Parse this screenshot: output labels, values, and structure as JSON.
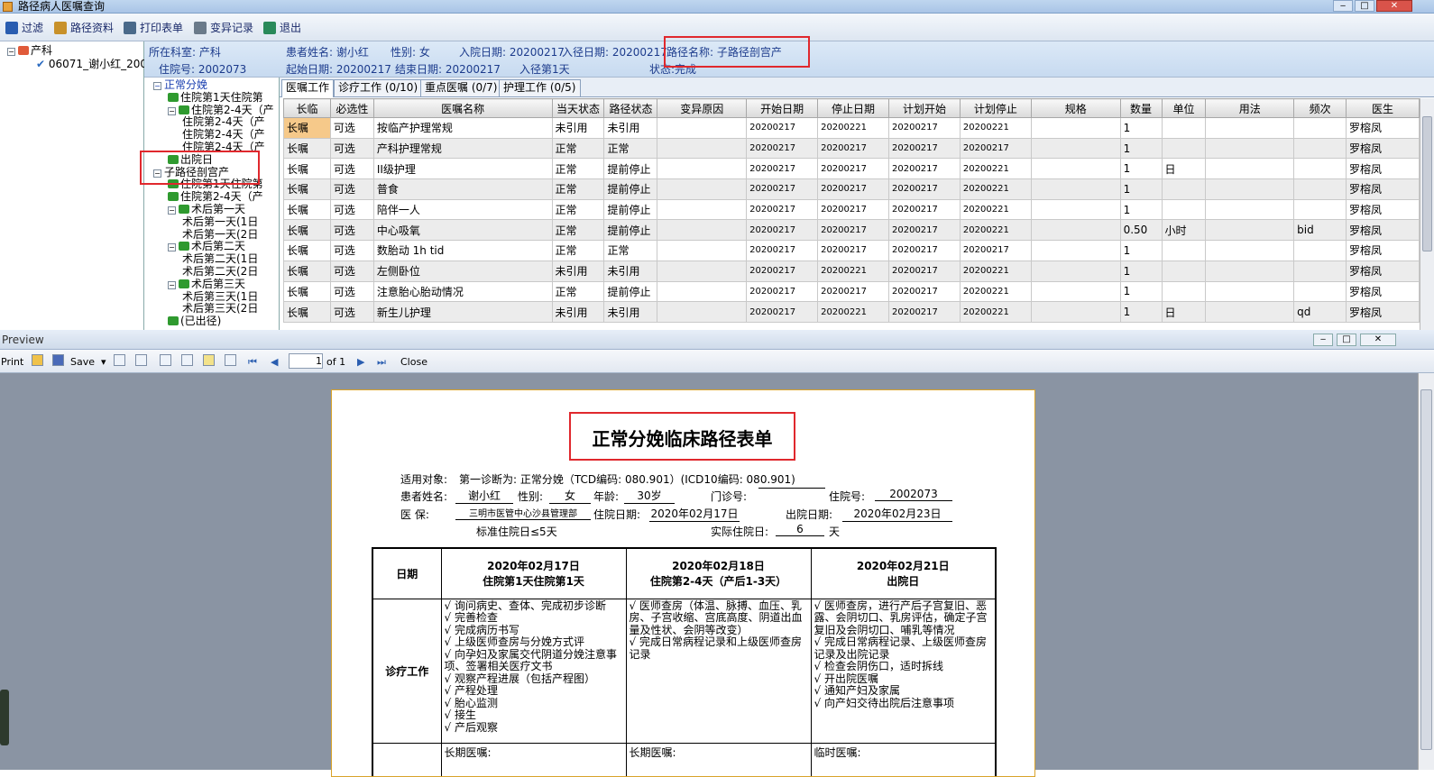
{
  "window": {
    "title": "路径病人医嘱查询",
    "btn_min": "‒",
    "btn_max": "□",
    "btn_close": "✕"
  },
  "toolbar": [
    {
      "label": "过滤",
      "icon": "filter-icon",
      "color": "#2a5db0"
    },
    {
      "label": "路径资料",
      "icon": "folder-icon",
      "color": "#c8912a"
    },
    {
      "label": "打印表单",
      "icon": "printer-icon",
      "color": "#4a6a8a"
    },
    {
      "label": "变异记录",
      "icon": "calculator-icon",
      "color": "#6a7a8a"
    },
    {
      "label": "退出",
      "icon": "exit-icon",
      "color": "#2a8a5a"
    }
  ],
  "tree_left": {
    "root": "产科",
    "child": "06071_谢小红_200"
  },
  "info": {
    "dept": "所在科室: 产科",
    "patient": "患者姓名: 谢小红",
    "gender": "性别:  女",
    "admit_date": "入院日期: 20200217",
    "path_in_date": "入径日期: 20200217",
    "path_name": "路径名称: 子路径剖宫产",
    "inpatient_no": "住院号: 2002073",
    "start_date": "起始日期: 20200217",
    "end_date": "结束日期: 20200217",
    "path_day": "入径第1天",
    "status": "状态:完成"
  },
  "tree_path": [
    {
      "text": "正常分娩",
      "level": 0,
      "type": "expander",
      "color": "#1a3fb0"
    },
    {
      "text": "住院第1天住院第",
      "level": 1,
      "type": "leaf"
    },
    {
      "text": "住院第2-4天（产",
      "level": 1,
      "type": "expleaf"
    },
    {
      "text": "住院第2-4天（产",
      "level": 2,
      "type": "text"
    },
    {
      "text": "住院第2-4天（产",
      "level": 2,
      "type": "text"
    },
    {
      "text": "住院第2-4天（产",
      "level": 2,
      "type": "text"
    },
    {
      "text": "出院日",
      "level": 1,
      "type": "leaf"
    },
    {
      "text": "子路径剖宫产",
      "level": 0,
      "type": "expander",
      "color": "#000"
    },
    {
      "text": "住院第1天住院第",
      "level": 1,
      "type": "leaf"
    },
    {
      "text": "住院第2-4天（产",
      "level": 1,
      "type": "leaf"
    },
    {
      "text": "术后第一天",
      "level": 1,
      "type": "expleaf"
    },
    {
      "text": "术后第一天(1日",
      "level": 2,
      "type": "text"
    },
    {
      "text": "术后第一天(2日",
      "level": 2,
      "type": "text"
    },
    {
      "text": "术后第二天",
      "level": 1,
      "type": "expleaf"
    },
    {
      "text": "术后第二天(1日",
      "level": 2,
      "type": "text"
    },
    {
      "text": "术后第二天(2日",
      "level": 2,
      "type": "text"
    },
    {
      "text": "术后第三天",
      "level": 1,
      "type": "expleaf"
    },
    {
      "text": "术后第三天(1日",
      "level": 2,
      "type": "text"
    },
    {
      "text": "术后第三天(2日",
      "level": 2,
      "type": "text"
    },
    {
      "text": "(已出径)",
      "level": 1,
      "type": "leaf"
    }
  ],
  "tabs": [
    "医嘱工作",
    "诊疗工作 (0/10)",
    "重点医嘱 (0/7)",
    "护理工作 (0/5)"
  ],
  "grid": {
    "columns": [
      "长临",
      "必选性",
      "医嘱名称",
      "当天状态",
      "路径状态",
      "变异原因",
      "开始日期",
      "停止日期",
      "计划开始",
      "计划停止",
      "规格",
      "数量",
      "单位",
      "用法",
      "频次",
      "医生"
    ],
    "rows": [
      [
        "长嘱",
        "可选",
        "按临产护理常规",
        "未引用",
        "未引用",
        "",
        "20200217",
        "20200221",
        "20200217",
        "20200221",
        "",
        "1",
        "",
        "",
        "",
        "罗榕凤"
      ],
      [
        "长嘱",
        "可选",
        "产科护理常规",
        "正常",
        "正常",
        "",
        "20200217",
        "20200217",
        "20200217",
        "20200217",
        "",
        "1",
        "",
        "",
        "",
        "罗榕凤"
      ],
      [
        "长嘱",
        "可选",
        "II级护理",
        "正常",
        "提前停止",
        "",
        "20200217",
        "20200217",
        "20200217",
        "20200221",
        "",
        "1",
        "日",
        "",
        "",
        "罗榕凤"
      ],
      [
        "长嘱",
        "可选",
        "普食",
        "正常",
        "提前停止",
        "",
        "20200217",
        "20200217",
        "20200217",
        "20200221",
        "",
        "1",
        "",
        "",
        "",
        "罗榕凤"
      ],
      [
        "长嘱",
        "可选",
        "陪伴一人",
        "正常",
        "提前停止",
        "",
        "20200217",
        "20200217",
        "20200217",
        "20200221",
        "",
        "1",
        "",
        "",
        "",
        "罗榕凤"
      ],
      [
        "长嘱",
        "可选",
        "中心吸氧",
        "正常",
        "提前停止",
        "",
        "20200217",
        "20200217",
        "20200217",
        "20200221",
        "",
        "0.50",
        "小时",
        "",
        "bid",
        "罗榕凤"
      ],
      [
        "长嘱",
        "可选",
        "数胎动 1h tid",
        "正常",
        "正常",
        "",
        "20200217",
        "20200217",
        "20200217",
        "20200217",
        "",
        "1",
        "",
        "",
        "",
        "罗榕凤"
      ],
      [
        "长嘱",
        "可选",
        "左侧卧位",
        "未引用",
        "未引用",
        "",
        "20200217",
        "20200221",
        "20200217",
        "20200221",
        "",
        "1",
        "",
        "",
        "",
        "罗榕凤"
      ],
      [
        "长嘱",
        "可选",
        "注意胎心胎动情况",
        "正常",
        "提前停止",
        "",
        "20200217",
        "20200217",
        "20200217",
        "20200221",
        "",
        "1",
        "",
        "",
        "",
        "罗榕凤"
      ],
      [
        "长嘱",
        "可选",
        "新生儿护理",
        "未引用",
        "未引用",
        "",
        "20200217",
        "20200221",
        "20200217",
        "20200221",
        "",
        "1",
        "日",
        "",
        "qd",
        "罗榕凤"
      ]
    ]
  },
  "preview": {
    "title": "Preview",
    "print": "Print",
    "save": "Save",
    "page_value": "1",
    "of_label": "of 1",
    "close": "Close"
  },
  "form": {
    "title": "正常分娩临床路径表单",
    "target_label": "适用对象:",
    "target_value": "第一诊断为: 正常分娩（TCD编码: 080.901）(ICD10编码: 080.901)",
    "name_label": "患者姓名:",
    "name_value": "谢小红",
    "gender_label": "性别:",
    "gender_value": "女",
    "age_label": "年龄:",
    "age_value": "30岁",
    "clinic_label": "门诊号:",
    "clinic_value": "",
    "inpatient_label": "住院号:",
    "inpatient_value": "2002073",
    "insurance_label": "医    保:",
    "insurance_value": "三明市医管中心沙县管理部",
    "admit_label": "住院日期:",
    "admit_value": "2020年02月17日",
    "discharge_label": "出院日期:",
    "discharge_value": "2020年02月23日",
    "standard_days": "标准住院日≤5天",
    "actual_label": "实际住院日:",
    "actual_value": "6",
    "actual_unit": "天",
    "col_date": "日期",
    "col1_date": "2020年02月17日",
    "col1_day": "住院第1天住院第1天",
    "col2_date": "2020年02月18日",
    "col2_day": "住院第2-4天（产后1-3天）",
    "col3_date": "2020年02月21日",
    "col3_day": "出院日",
    "row_label": "诊疗工作",
    "col1_items": [
      "√ 询问病史、查体、完成初步诊断",
      "√ 完善检查",
      "√ 完成病历书写",
      "√ 上级医师查房与分娩方式评",
      "√ 向孕妇及家属交代阴道分娩注意事项、签署相关医疗文书",
      "√ 观察产程进展（包括产程图）",
      "√ 产程处理",
      "√ 胎心监测",
      "√ 接生",
      "√ 产后观察"
    ],
    "col2_items": [
      "√ 医师查房（体温、脉搏、血压、乳房、子宫收缩、宫底高度、阴道出血量及性状、会阴等改变）",
      "√ 完成日常病程记录和上级医师查房记录"
    ],
    "col3_items": [
      "√ 医师查房，进行产后子宫复旧、恶露、会阴切口、乳房评估，确定子宫复旧及会阴切口、哺乳等情况",
      "√ 完成日常病程记录、上级医师查房记录及出院记录",
      "√ 检查会阴伤口，适时拆线",
      "√ 开出院医嘱",
      "√ 通知产妇及家属",
      "√ 向产妇交待出院后注意事项"
    ],
    "next_col1": "长期医嘱:",
    "next_col2": "长期医嘱:",
    "next_col3": "临时医嘱:"
  }
}
